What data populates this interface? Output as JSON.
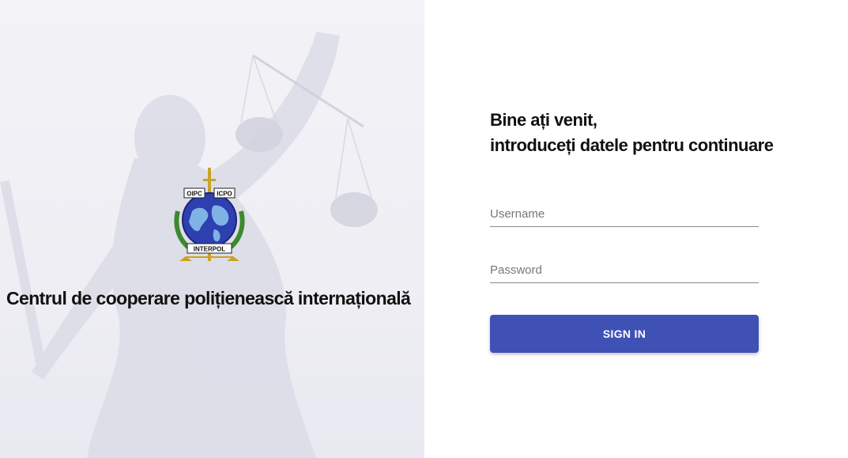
{
  "left": {
    "organization_title": "Centrul de cooperare polițienească internațională",
    "logo": {
      "icon": "interpol-logo",
      "text_top_left": "OIPC",
      "text_top_right": "ICPO",
      "text_bottom": "INTERPOL"
    },
    "background_icon": "justice-statue-image"
  },
  "login": {
    "welcome_line1": "Bine ați venit,",
    "welcome_line2": "introduceți datele pentru continuare",
    "username_placeholder": "Username",
    "password_placeholder": "Password",
    "signin_label": "SIGN IN"
  },
  "colors": {
    "accent": "#3f51b5",
    "text": "#111111"
  }
}
